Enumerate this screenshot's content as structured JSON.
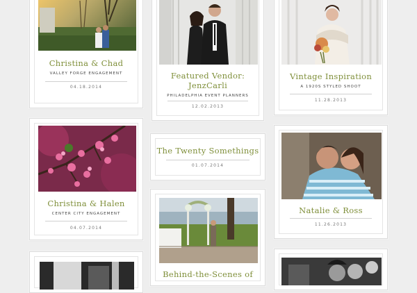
{
  "cards": [
    {
      "title": "Christina & Chad",
      "subtitle": "Valley Forge Engagement",
      "date": "04.18.2014",
      "image": "couple-at-sunset-photo"
    },
    {
      "title_line1": "Featured Vendor:",
      "title_line2": "JenzCarli",
      "subtitle": "Philadelphia Event Planners",
      "date": "12.02.2013",
      "image": "bride-and-groom-photo"
    },
    {
      "title": "Vintage Inspiration",
      "subtitle": "A 1920s Styled Shoot",
      "date": "11.28.2013",
      "image": "vintage-bride-photo"
    },
    {
      "title": "Christina & Halen",
      "subtitle": "Center City Engagement",
      "date": "04.07.2014",
      "image": "pink-blossoms-photo"
    },
    {
      "title": "The Twenty Somethings",
      "date": "01.07.2014"
    },
    {
      "title": "Natalie & Ross",
      "date": "11.26.2013",
      "image": "couple-in-blanket-photo"
    },
    {
      "title": "Behind-the-Scenes of",
      "image": "wedding-ceremony-setup-photo"
    },
    {
      "image": "black-and-white-photo"
    },
    {
      "image": "black-and-white-group-photo"
    }
  ]
}
